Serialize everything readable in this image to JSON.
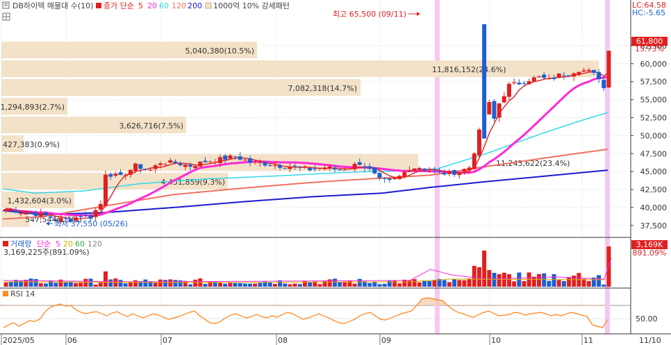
{
  "toolbar": {
    "title": "DB하이텍 매물대 수(10)",
    "legend_price_label": "종가 단순",
    "ma_periods": [
      "5",
      "20",
      "60",
      "120",
      "200"
    ],
    "extra": "1000억 10% 강세패턴"
  },
  "lc_label": "LC:64.58",
  "hc_label": "HC:-5.65",
  "price_axis_ticks": [
    "62,500",
    "60,000",
    "57,500",
    "55,000",
    "52,500",
    "50,000",
    "47,500",
    "45,000",
    "42,500",
    "40,000",
    "37,500"
  ],
  "current_price": {
    "value": "61,800",
    "pct": "15.73%"
  },
  "annotations": {
    "high": "최고 65,500 (09/11)",
    "low": "최저 37,550 (05/26)"
  },
  "volume_profile": [
    {
      "label": "5,040,380(10.5%)"
    },
    {
      "label": "11,816,152(24.6%)"
    },
    {
      "label": "7,082,318(14.7%)"
    },
    {
      "label": "1,294,893(2.7%)"
    },
    {
      "label": "3,626,716(7.5%)"
    },
    {
      "label": "427,383(0.9%)"
    },
    {
      "label": "11,243,622(23.4%)"
    },
    {
      "label": "4,451,859(9.3%)"
    },
    {
      "label": "1,432,604(3.0%)"
    },
    {
      "label": "547,544(1.1%)"
    }
  ],
  "volume_panel": {
    "title": "거래량",
    "legend_label": "단순",
    "ma_periods": [
      "5",
      "20",
      "60",
      "120"
    ],
    "value": "3,169,225주(891.09%)",
    "badge_value": "3,169K",
    "badge_pct": "891.09%"
  },
  "rsi_panel": {
    "title": "RSI 14",
    "tick": "50.00"
  },
  "x_axis": [
    "2025/05",
    "06",
    "07",
    "08",
    "09",
    "10",
    "11",
    "11/10"
  ],
  "colors": {
    "up": "#e02020",
    "down": "#1e5fd0",
    "ma5": "#e02020",
    "ma20": "#ff28d8",
    "ma60": "#34d8e8",
    "ma120": "#f07060",
    "ma200": "#1a1ad0",
    "vp": "#f3e2c8",
    "rsi": "#ff8c2a"
  }
}
